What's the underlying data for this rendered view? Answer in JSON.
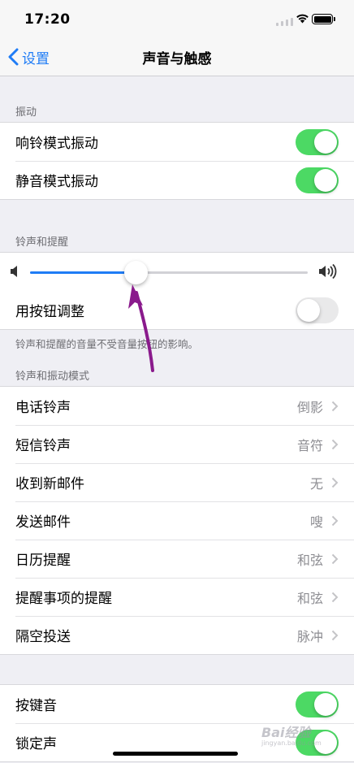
{
  "status_bar": {
    "time": "17:20"
  },
  "nav": {
    "back_label": "设置",
    "title": "声音与触感"
  },
  "vibration": {
    "header": "振动",
    "rows": [
      {
        "label": "响铃模式振动",
        "toggle": "on"
      },
      {
        "label": "静音模式振动",
        "toggle": "on"
      }
    ]
  },
  "ringer": {
    "header": "铃声和提醒",
    "volume_level": 0.38,
    "adjust_label": "用按钮调整",
    "adjust_toggle": "off",
    "footnote": "铃声和提醒的音量不受音量按钮的影响。"
  },
  "patterns": {
    "header": "铃声和振动模式",
    "rows": [
      {
        "label": "电话铃声",
        "value": "倒影"
      },
      {
        "label": "短信铃声",
        "value": "音符"
      },
      {
        "label": "收到新邮件",
        "value": "无"
      },
      {
        "label": "发送邮件",
        "value": "嗖"
      },
      {
        "label": "日历提醒",
        "value": "和弦"
      },
      {
        "label": "提醒事项的提醒",
        "value": "和弦"
      },
      {
        "label": "隔空投送",
        "value": "脉冲"
      }
    ]
  },
  "system_sounds": {
    "rows": [
      {
        "label": "按键音",
        "toggle": "on"
      },
      {
        "label": "锁定声",
        "toggle": "on"
      }
    ]
  },
  "watermark": {
    "text": "Bai经验",
    "sub": "jingyan.baidu.com"
  },
  "colors": {
    "accent": "#1f7cf6",
    "toggle_on": "#4cd964",
    "annotation_arrow": "#8a1a8c"
  }
}
